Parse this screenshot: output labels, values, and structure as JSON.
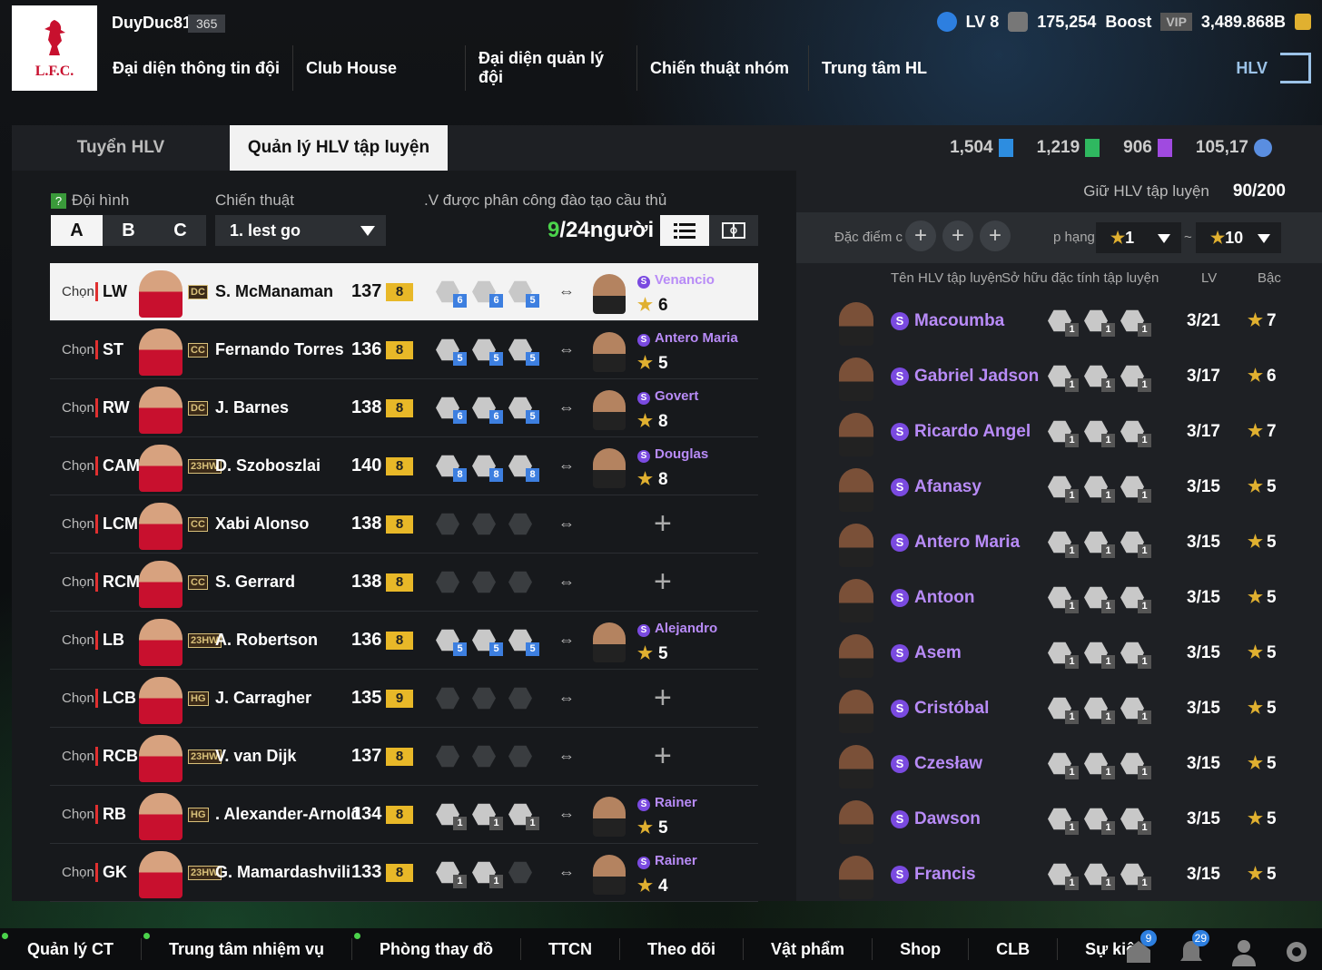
{
  "header": {
    "club_logo_text": "L.F.C.",
    "username": "DuyDuc81",
    "user_level": "365",
    "level": "LV 8",
    "trophy_count": "175,254",
    "boost_label": "Boost",
    "vip_label": "VIP",
    "coins": "3,489.868B",
    "nav": [
      "Đại diện thông tin đội",
      "Club House",
      "Đại diện quản lý đội",
      "Chiến thuật nhóm",
      "Trung tâm HL"
    ],
    "hlv_label": "HLV"
  },
  "tabs": [
    "Tuyển HLV",
    "Quản lý HLV tập luyện"
  ],
  "currency": [
    "1,504",
    "1,219",
    "906",
    "105,17"
  ],
  "left": {
    "formation_label": "Đội hình",
    "tactic_label": "Chiến thuật",
    "assigned_label": ".V được phân công đào tạo cầu thủ",
    "formation_options": [
      "A",
      "B",
      "C"
    ],
    "tactic_value": "1. lest go",
    "assigned_count": "9",
    "assigned_total": "/24người",
    "choose_label": "Chọn"
  },
  "players": [
    {
      "pos": "LW",
      "badge": "DC",
      "name": "S. McManaman",
      "ovr": "137",
      "lv": "8",
      "skills": [
        "6",
        "6",
        "5"
      ],
      "coach": "Venancio",
      "coach_grade": "6"
    },
    {
      "pos": "ST",
      "badge": "CC",
      "name": "Fernando Torres",
      "ovr": "136",
      "lv": "8",
      "skills": [
        "5",
        "5",
        "5"
      ],
      "coach": "Antero Maria",
      "coach_grade": "5"
    },
    {
      "pos": "RW",
      "badge": "DC",
      "name": "J. Barnes",
      "ovr": "138",
      "lv": "8",
      "skills": [
        "6",
        "6",
        "5"
      ],
      "coach": "Govert",
      "coach_grade": "8"
    },
    {
      "pos": "CAM",
      "badge": "23HW",
      "name": "D. Szoboszlai",
      "ovr": "140",
      "lv": "8",
      "skills": [
        "8",
        "8",
        "8"
      ],
      "coach": "Douglas",
      "coach_grade": "8"
    },
    {
      "pos": "LCM",
      "badge": "CC",
      "name": "Xabi Alonso",
      "ovr": "138",
      "lv": "8",
      "skills": [],
      "coach": "",
      "coach_grade": ""
    },
    {
      "pos": "RCM",
      "badge": "CC",
      "name": "S. Gerrard",
      "ovr": "138",
      "lv": "8",
      "skills": [],
      "coach": "",
      "coach_grade": ""
    },
    {
      "pos": "LB",
      "badge": "23HW",
      "name": "A. Robertson",
      "ovr": "136",
      "lv": "8",
      "skills": [
        "5",
        "5",
        "5"
      ],
      "coach": "Alejandro",
      "coach_grade": "5"
    },
    {
      "pos": "LCB",
      "badge": "HG",
      "name": "J. Carragher",
      "ovr": "135",
      "lv": "9",
      "skills": [],
      "coach": "",
      "coach_grade": ""
    },
    {
      "pos": "RCB",
      "badge": "23HW",
      "name": "V. van Dijk",
      "ovr": "137",
      "lv": "8",
      "skills": [],
      "coach": "",
      "coach_grade": ""
    },
    {
      "pos": "RB",
      "badge": "HG",
      "name": ". Alexander-Arnold",
      "ovr": "134",
      "lv": "8",
      "skills": [
        "1",
        "1",
        "1"
      ],
      "coach": "Rainer",
      "coach_grade": "5"
    },
    {
      "pos": "GK",
      "badge": "23HW",
      "name": "G. Mamardashvili",
      "ovr": "133",
      "lv": "8",
      "skills": [
        "1",
        "1"
      ],
      "coach": "Rainer",
      "coach_grade": "4"
    }
  ],
  "right": {
    "keep_label": "Giữ HLV tập luyện",
    "keep_value": "90/200",
    "trait_label": "Đặc điểm c",
    "rank_label": "p hạng",
    "rank_min": "1",
    "rank_sep": "~",
    "rank_max": "10",
    "col_name": "Tên HLV tập luyện",
    "col_traits": "Sở hữu đặc tính tập luyện",
    "col_lv": "LV",
    "col_grade": "Bậc"
  },
  "coaches": [
    {
      "name": "Macoumba",
      "lv": "3/21",
      "grade": "7"
    },
    {
      "name": "Gabriel Jadson",
      "lv": "3/17",
      "grade": "6"
    },
    {
      "name": "Ricardo Angel",
      "lv": "3/17",
      "grade": "7"
    },
    {
      "name": "Afanasy",
      "lv": "3/15",
      "grade": "5"
    },
    {
      "name": "Antero Maria",
      "lv": "3/15",
      "grade": "5"
    },
    {
      "name": "Antoon",
      "lv": "3/15",
      "grade": "5"
    },
    {
      "name": "Asem",
      "lv": "3/15",
      "grade": "5"
    },
    {
      "name": "Cristóbal",
      "lv": "3/15",
      "grade": "5"
    },
    {
      "name": "Czesław",
      "lv": "3/15",
      "grade": "5"
    },
    {
      "name": "Dawson",
      "lv": "3/15",
      "grade": "5"
    },
    {
      "name": "Francis",
      "lv": "3/15",
      "grade": "5"
    }
  ],
  "bottom_nav": [
    "Quản lý CT",
    "Trung tâm nhiệm vụ",
    "Phòng thay đồ",
    "TTCN",
    "Theo dõi",
    "Vật phẩm",
    "Shop",
    "CLB",
    "Sự kiện"
  ],
  "notifications": {
    "mail": "9",
    "bell": "29"
  },
  "colors": {
    "accent_purple": "#b88bf7",
    "star_gold": "#e0b030",
    "level_yellow": "#e8b828",
    "skill_blue": "#3d7fe0"
  }
}
